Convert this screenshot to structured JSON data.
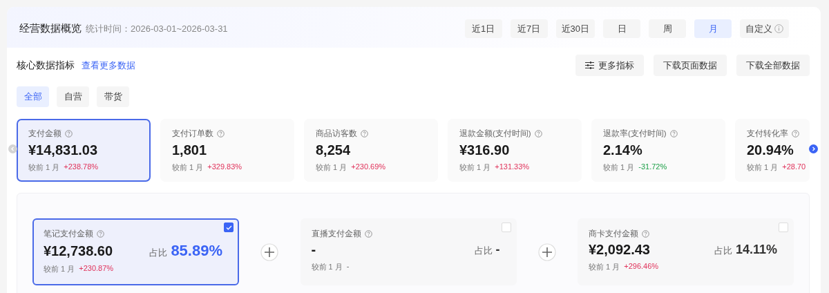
{
  "overview": {
    "title": "经营数据概览",
    "period": "统计时间：2026-03-01~2026-03-31"
  },
  "ranges": [
    {
      "label": "近1日",
      "selected": false
    },
    {
      "label": "近7日",
      "selected": false
    },
    {
      "label": "近30日",
      "selected": false
    },
    {
      "label": "日",
      "selected": false
    },
    {
      "label": "周",
      "selected": false
    },
    {
      "label": "月",
      "selected": true
    },
    {
      "label": "自定义",
      "selected": false,
      "info": true
    }
  ],
  "core": {
    "title": "核心数据指标",
    "link": "查看更多数据",
    "actions": [
      {
        "label": "更多指标",
        "kind": "filter"
      },
      {
        "label": "下载页面数据",
        "kind": "plain"
      },
      {
        "label": "下载全部数据",
        "kind": "plain"
      }
    ],
    "tabs": [
      {
        "label": "全部",
        "selected": true
      },
      {
        "label": "自营",
        "selected": false
      },
      {
        "label": "带货",
        "selected": false
      }
    ],
    "metrics": [
      {
        "name": "支付金额",
        "value": "¥14,831.03",
        "compare": "较前 1 月",
        "delta": "+238.78%",
        "color": "#e0325a",
        "selected": true
      },
      {
        "name": "支付订单数",
        "value": "1,801",
        "compare": "较前 1 月",
        "delta": "+329.83%",
        "color": "#e0325a",
        "selected": false
      },
      {
        "name": "商品访客数",
        "value": "8,254",
        "compare": "较前 1 月",
        "delta": "+230.69%",
        "color": "#e0325a",
        "selected": false
      },
      {
        "name": "退款金额(支付时间)",
        "value": "¥316.90",
        "compare": "较前 1 月",
        "delta": "+131.33%",
        "color": "#e0325a",
        "selected": false
      },
      {
        "name": "退款率(支付时间)",
        "value": "2.14%",
        "compare": "较前 1 月",
        "delta": "-31.72%",
        "color": "#1a9e45",
        "selected": false
      },
      {
        "name": "支付转化率",
        "value": "20.94%",
        "compare": "较前 1 月",
        "delta": "+28.70",
        "color": "#e0325a",
        "selected": false
      }
    ],
    "breakdown": [
      {
        "name": "笔记支付金额",
        "value": "¥12,738.60",
        "share_label": "占比",
        "share": "85.89%",
        "compare": "较前 1 月",
        "delta": "+230.87%",
        "color": "#e0325a",
        "checked": true
      },
      {
        "name": "直播支付金额",
        "value": "-",
        "share_label": "占比",
        "share": "-",
        "compare": "较前 1 月",
        "delta": "-",
        "checked": false
      },
      {
        "name": "商卡支付金额",
        "value": "¥2,092.43",
        "share_label": "占比",
        "share": "14.11%",
        "compare": "较前 1 月",
        "delta": "+296.46%",
        "color": "#e0325a",
        "checked": false
      }
    ]
  }
}
